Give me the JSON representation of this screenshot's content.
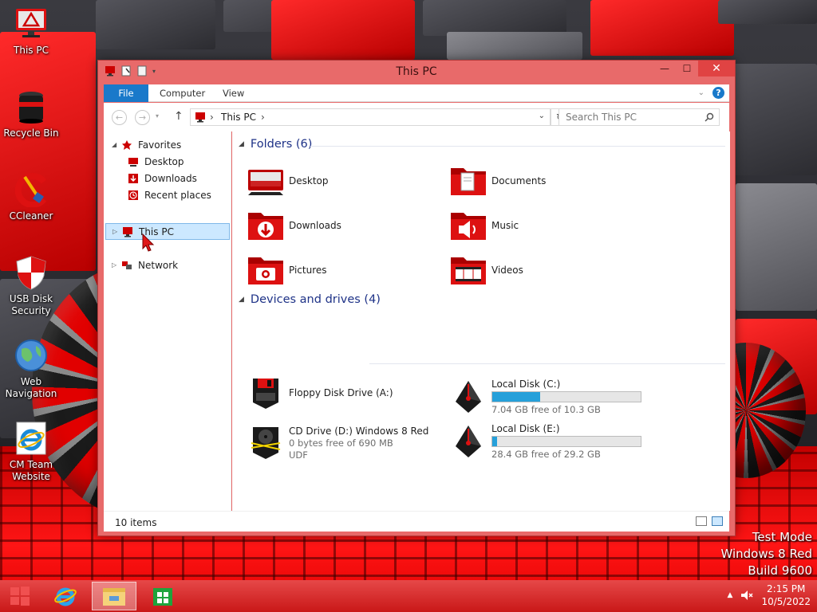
{
  "desktop": {
    "icons": [
      {
        "label": "This PC",
        "icon": "computer-icon"
      },
      {
        "label": "Recycle Bin",
        "icon": "recycle-bin-icon"
      },
      {
        "label": "CCleaner",
        "icon": "ccleaner-icon"
      },
      {
        "label": "USB Disk Security",
        "icon": "shield-icon"
      },
      {
        "label": "Web Navigation",
        "icon": "globe-icon"
      },
      {
        "label": "CM Team Website",
        "icon": "internet-explorer-icon"
      }
    ]
  },
  "window": {
    "title": "This PC",
    "controls": {
      "minimize": "—",
      "maximize": "☐",
      "close": "✕"
    },
    "ribbon": {
      "tabs": [
        "File",
        "Computer",
        "View"
      ],
      "help": "?"
    },
    "address": {
      "path": "This PC",
      "separator": "›"
    },
    "search": {
      "placeholder": "Search This PC"
    },
    "nav_pane": {
      "favorites": {
        "label": "Favorites",
        "items": [
          "Desktop",
          "Downloads",
          "Recent places"
        ]
      },
      "this_pc": "This PC",
      "network": "Network"
    },
    "folders": {
      "heading": "Folders (6)",
      "items": [
        {
          "name": "Desktop",
          "icon": "desktop-folder-icon"
        },
        {
          "name": "Documents",
          "icon": "documents-folder-icon"
        },
        {
          "name": "Downloads",
          "icon": "downloads-folder-icon"
        },
        {
          "name": "Music",
          "icon": "music-folder-icon"
        },
        {
          "name": "Pictures",
          "icon": "pictures-folder-icon"
        },
        {
          "name": "Videos",
          "icon": "videos-folder-icon"
        }
      ]
    },
    "devices": {
      "heading": "Devices and drives (4)",
      "items": [
        {
          "name": "Floppy Disk Drive (A:)",
          "icon": "floppy-drive-icon"
        },
        {
          "name": "Local Disk (C:)",
          "free": "7.04 GB free of 10.3 GB",
          "used_fraction": 0.32,
          "icon": "local-disk-icon"
        },
        {
          "name": "CD Drive (D:) Windows 8 Red",
          "free": "0 bytes free of 690 MB",
          "fs": "UDF",
          "icon": "cd-drive-icon"
        },
        {
          "name": "Local Disk (E:)",
          "free": "28.4 GB free of 29.2 GB",
          "used_fraction": 0.03,
          "icon": "local-disk-icon"
        }
      ]
    },
    "status": "10 items"
  },
  "watermark": [
    "Test Mode",
    "Windows 8 Red",
    "Build 9600"
  ],
  "taskbar": {
    "clock": {
      "time": "2:15 PM",
      "date": "10/5/2022"
    }
  },
  "colors": {
    "accent": "#1979ca",
    "window_frame": "#e86a6a",
    "heading": "#1e3287",
    "bar_fill": "#26a0da",
    "taskbar": "#d42828"
  }
}
